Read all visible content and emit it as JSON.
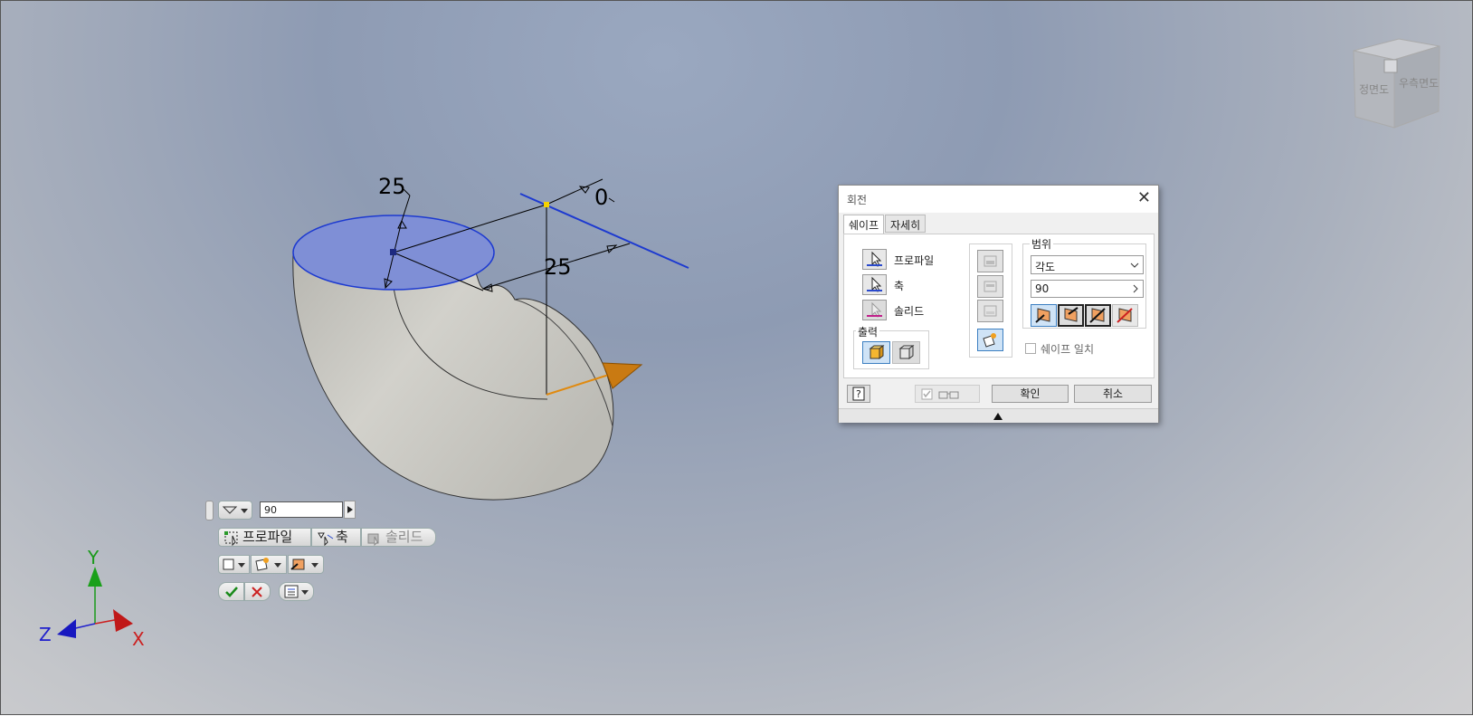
{
  "viewport": {
    "dimensions": {
      "top_left": "25",
      "top_right": "0",
      "middle": "25"
    },
    "viewcube": {
      "front_label": "정면도",
      "right_label": "우측면도"
    },
    "axis_triad": {
      "x": "X",
      "y": "Y",
      "z": "Z"
    }
  },
  "dialog": {
    "title": "회전",
    "tabs": [
      {
        "label": "쉐이프"
      },
      {
        "label": "자세히"
      }
    ],
    "selectors": {
      "profile": "프로파일",
      "axis": "축",
      "solid": "솔리드"
    },
    "output": {
      "title": "출력"
    },
    "extents": {
      "title": "범위",
      "type_value": "각도",
      "angle_value": "90"
    },
    "match_shape": {
      "label": "쉐이프 일치",
      "checked": false
    },
    "ok_label": "확인",
    "cancel_label": "취소"
  },
  "mini_toolbar": {
    "value": "90",
    "profile_label": "프로파일",
    "axis_label": "축",
    "solid_label": "솔리드"
  },
  "colors": {
    "profile_face": "#7f8fd6",
    "axis_line": "#1d3ad0",
    "direction_arrow": "#e08a10",
    "solid_body": "#c7c6c0",
    "ok_green": "#1a8a1a",
    "cancel_red": "#cc2020"
  }
}
